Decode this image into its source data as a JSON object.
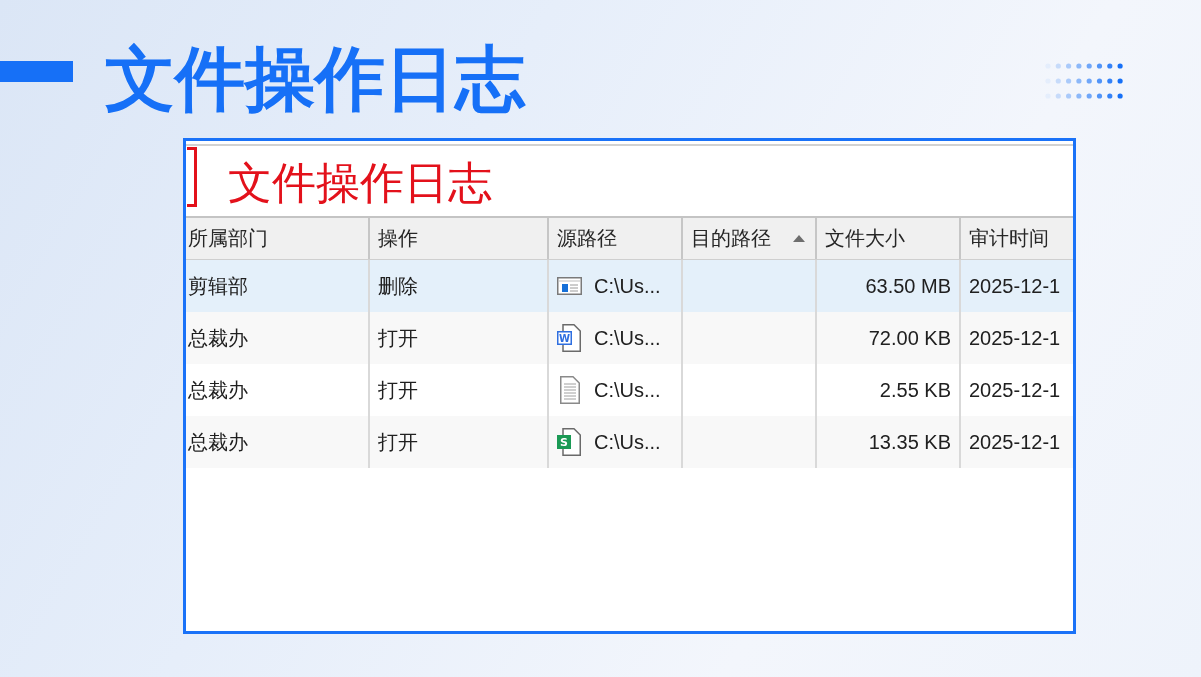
{
  "slide": {
    "title": "文件操作日志"
  },
  "screenshot": {
    "caption": "文件操作日志",
    "table": {
      "columns": [
        {
          "label": "所属部门",
          "sorted": false
        },
        {
          "label": "操作",
          "sorted": false
        },
        {
          "label": "源路径",
          "sorted": false
        },
        {
          "label": "目的路径",
          "sorted": true
        },
        {
          "label": "文件大小",
          "sorted": false
        },
        {
          "label": "审计时间",
          "sorted": false
        }
      ],
      "rows": [
        {
          "selected": true,
          "department": "剪辑部",
          "operation": "删除",
          "source": {
            "kind": "window",
            "path": "C:\\Us..."
          },
          "size": "63.50 MB",
          "time": "2025-12-1"
        },
        {
          "selected": false,
          "department": "总裁办",
          "operation": "打开",
          "source": {
            "kind": "doc",
            "letter": "W",
            "path": "C:\\Us..."
          },
          "size": "72.00 KB",
          "time": "2025-12-1"
        },
        {
          "selected": false,
          "department": "总裁办",
          "operation": "打开",
          "source": {
            "kind": "text",
            "path": "C:\\Us..."
          },
          "size": "2.55 KB",
          "time": "2025-12-1"
        },
        {
          "selected": false,
          "department": "总裁办",
          "operation": "打开",
          "source": {
            "kind": "sheet",
            "letter": "S",
            "path": "C:\\Us..."
          },
          "size": "13.35 KB",
          "time": "2025-12-1"
        }
      ]
    }
  }
}
